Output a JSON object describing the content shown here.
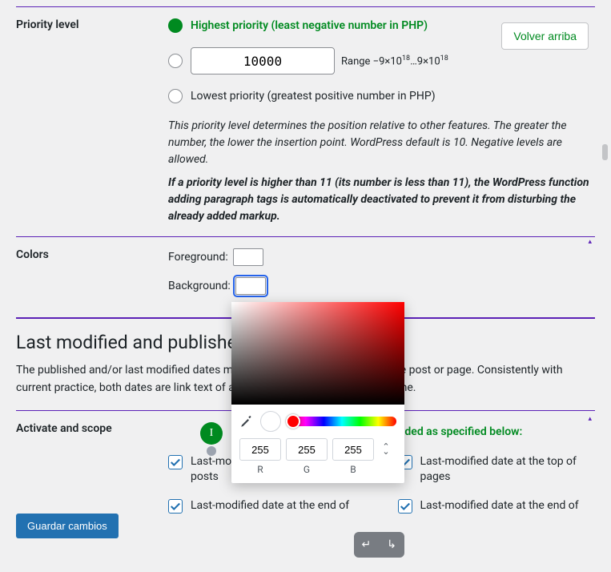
{
  "buttons": {
    "back_to_top": "Volver arriba",
    "save_changes": "Guardar cambios"
  },
  "priority": {
    "section_label": "Priority level",
    "option_highest": "Highest priority (least negative number in PHP)",
    "option_lowest": "Lowest priority (greatest positive number in PHP)",
    "value": "10000",
    "range_text": "Range −9×10¹⁸…9×10¹⁸",
    "desc1": "This priority level determines the position relative to other features. The greater the number, the lower the insertion point. WordPress default is 10. Negative levels are allowed.",
    "desc2": "If a priority level is higher than 11 (its number is less than 11), the WordPress function adding paragraph tags is automatically deactivated to prevent it from disturbing the already added markup."
  },
  "colors": {
    "section_label": "Colors",
    "foreground_label": "Foreground:",
    "background_label": "Background:",
    "foreground_value": "#000000",
    "background_value": "#ffffff"
  },
  "section2": {
    "heading": "Last modified and published dates",
    "intro": "The published and/or last modified dates may be displayed near the title of the post or page. Consistently with current practice, both dates are link text of a permalink. A tooltip shows the time."
  },
  "activate": {
    "section_label": "Activate and scope",
    "toggle_state": "I",
    "added_text": "added as specified below:",
    "checkboxes": [
      {
        "label": "Last-modified date at the top of posts",
        "checked": true
      },
      {
        "label": "Last-modified date at the top of pages",
        "checked": true
      },
      {
        "label": "Last-modified date at the end of",
        "checked": true
      },
      {
        "label": "Last-modified date at the end of",
        "checked": true
      }
    ]
  },
  "color_picker": {
    "r": "255",
    "g": "255",
    "b": "255",
    "lbl_r": "R",
    "lbl_g": "G",
    "lbl_b": "B"
  }
}
